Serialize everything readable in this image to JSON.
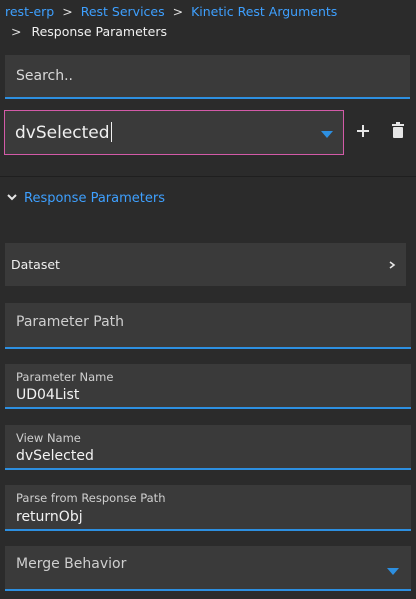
{
  "breadcrumb": {
    "items": [
      "rest-erp",
      "Rest Services",
      "Kinetic Rest Arguments"
    ],
    "current": "Response Parameters",
    "separator": ">"
  },
  "search": {
    "placeholder": "Search.."
  },
  "dataset_select": {
    "value": "dvSelected"
  },
  "section": {
    "title": "Response Parameters"
  },
  "dataset_row": {
    "label": "Dataset"
  },
  "fields": {
    "parameter_path": {
      "label": "Parameter Path"
    },
    "parameter_name": {
      "label": "Parameter Name",
      "value": "UD04List"
    },
    "view_name": {
      "label": "View Name",
      "value": "dvSelected"
    },
    "parse_path": {
      "label": "Parse from Response Path",
      "value": "returnObj"
    },
    "merge_behavior": {
      "label": "Merge Behavior"
    }
  },
  "colors": {
    "accent": "#2d8fe0",
    "link": "#3ea0ff",
    "focus_border": "#d35aa8",
    "background": "#2b2b2b",
    "panel": "#3a3a3a"
  }
}
